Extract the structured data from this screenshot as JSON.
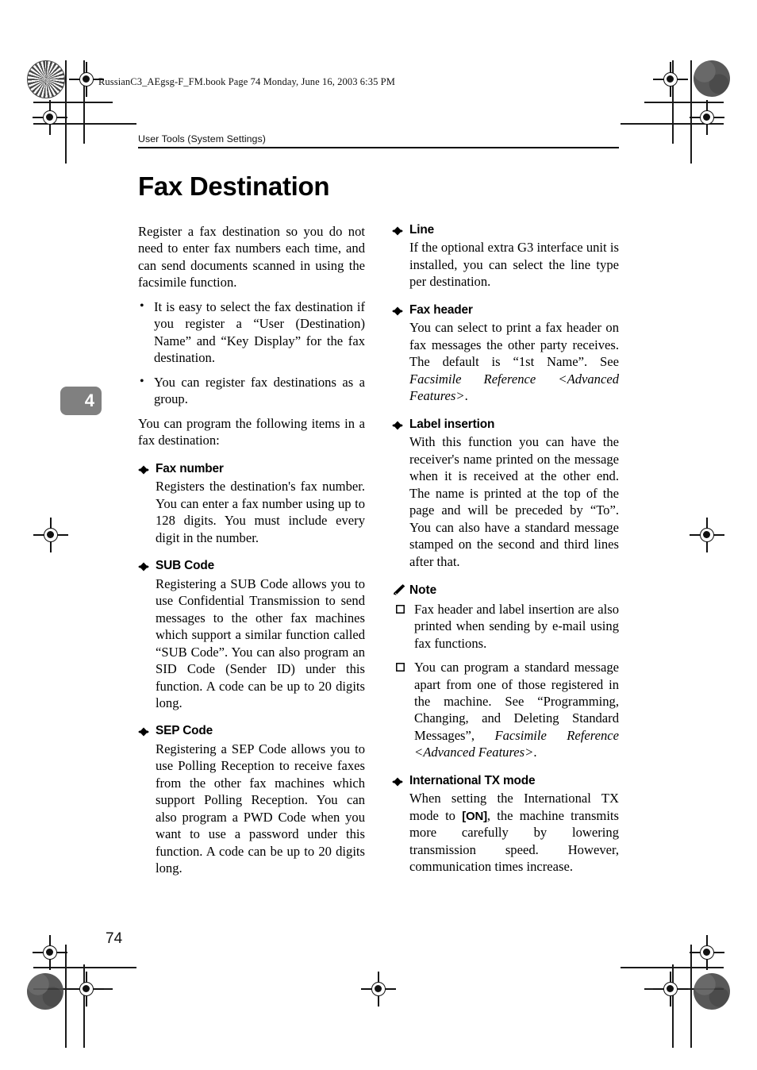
{
  "slug": "RussianC3_AEgsg-F_FM.book  Page 74  Monday, June 16, 2003  6:35 PM",
  "running_header": "User Tools (System Settings)",
  "page_title": "Fax Destination",
  "chapter_tab": "4",
  "folio": "74",
  "icons": {
    "diamond": "diamond-bullet-icon",
    "pencil": "pencil-note-icon",
    "square": "hollow-square-bullet-icon",
    "round": "•"
  },
  "colors": {
    "text": "#000000",
    "chapter_tab_bg": "#808080",
    "chapter_tab_text": "#ffffff",
    "rule": "#000000"
  },
  "left_column": {
    "intro": "Register a fax destination so you do not need to enter fax numbers each time, and can send documents scanned in using the facsimile function.",
    "bullets": [
      "It is easy to select the fax destination if you register a “User (Destination) Name” and “Key Display” for the fax destination.",
      "You can register fax destinations as a group."
    ],
    "lead_in": "You can program the following items in a fax destination:",
    "sections": [
      {
        "heading": "Fax number",
        "body": "Registers the destination's fax number. You can enter a fax number using up to 128 digits. You must include every digit in the number."
      },
      {
        "heading": "SUB Code",
        "body": "Registering a SUB Code allows you to use Confidential Transmission to send messages to the other fax machines which support a similar function called “SUB Code”. You can also program an SID Code (Sender ID) under this function. A code can be up to 20 digits long."
      },
      {
        "heading": "SEP Code",
        "body": "Registering a SEP Code allows you to use Polling Reception to receive faxes from the other fax machines which support Polling Reception. You can also program a PWD Code when you want to use a password under this function. A code can be up to 20 digits long."
      }
    ]
  },
  "right_column": {
    "sections": [
      {
        "heading": "Line",
        "body": "If the optional extra G3 interface unit is installed, you can select the line type per destination."
      },
      {
        "heading": "Fax header",
        "body_part1": "You can select to print a fax header on fax messages the other party receives. The default is “1st Name”. See ",
        "body_italic": "Facsimile Reference <Advanced Features>",
        "body_part2": "."
      },
      {
        "heading": "Label insertion",
        "body": "With this function you can have the receiver's name printed on the message when it is received at the other end. The name is printed at the top of the page and will be preceded by “To”. You can also have a standard message stamped on the second and third lines after that."
      }
    ],
    "note": {
      "heading": "Note",
      "items": [
        {
          "text": "Fax header and label insertion are also printed when sending by e-mail using fax functions."
        },
        {
          "part1": "You can program a standard message apart from one of those registered in the machine. See “Programming, Changing, and Deleting Standard Messages”, ",
          "italic": "Facsimile Reference <Advanced Features>",
          "part2": "."
        }
      ]
    },
    "final_section": {
      "heading": "International TX mode",
      "body_part1": "When setting the International TX mode to ",
      "key": "[ON]",
      "body_part2": ", the machine transmits more carefully by lowering transmission speed. However, communication times increase."
    }
  }
}
